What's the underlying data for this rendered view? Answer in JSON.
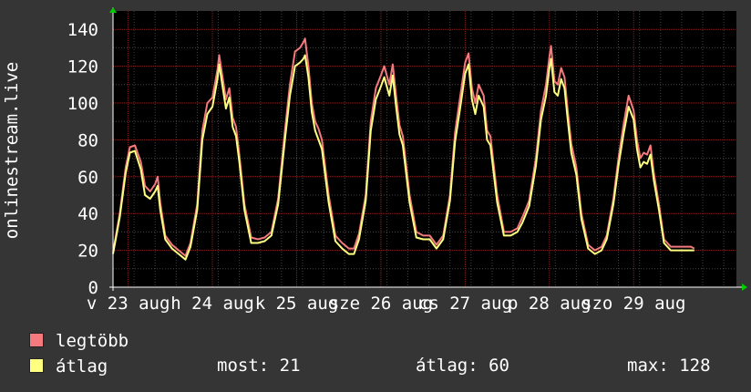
{
  "chart_data": {
    "type": "line",
    "ylabel": "onlinestream.live",
    "ylim": [
      0,
      150
    ],
    "yticks": [
      0,
      20,
      40,
      60,
      80,
      100,
      120,
      140
    ],
    "xlim": [
      0,
      7.4
    ],
    "xtick_labels": [
      {
        "x": 0.18,
        "label": "v 23 aug"
      },
      {
        "x": 1.18,
        "label": "h 24 aug"
      },
      {
        "x": 2.18,
        "label": "k 25 aug"
      },
      {
        "x": 3.18,
        "label": "sze 26 aug"
      },
      {
        "x": 4.18,
        "label": "cs 27 aug"
      },
      {
        "x": 5.18,
        "label": "p 28 aug"
      },
      {
        "x": 6.18,
        "label": "szo 29 aug"
      }
    ],
    "grid": true,
    "series": [
      {
        "name": "legtöbb",
        "color": "#f47a7d",
        "points": [
          [
            0.0,
            19
          ],
          [
            0.08,
            40
          ],
          [
            0.15,
            65
          ],
          [
            0.2,
            76
          ],
          [
            0.26,
            77
          ],
          [
            0.33,
            68
          ],
          [
            0.38,
            55
          ],
          [
            0.44,
            52
          ],
          [
            0.5,
            56
          ],
          [
            0.53,
            60
          ],
          [
            0.56,
            46
          ],
          [
            0.62,
            28
          ],
          [
            0.7,
            23
          ],
          [
            0.78,
            20
          ],
          [
            0.86,
            17
          ],
          [
            0.92,
            24
          ],
          [
            1.0,
            45
          ],
          [
            1.06,
            85
          ],
          [
            1.12,
            100
          ],
          [
            1.18,
            103
          ],
          [
            1.24,
            118
          ],
          [
            1.26,
            126
          ],
          [
            1.3,
            114
          ],
          [
            1.34,
            102
          ],
          [
            1.38,
            108
          ],
          [
            1.42,
            92
          ],
          [
            1.46,
            87
          ],
          [
            1.5,
            72
          ],
          [
            1.56,
            45
          ],
          [
            1.64,
            27
          ],
          [
            1.72,
            26
          ],
          [
            1.8,
            27
          ],
          [
            1.88,
            30
          ],
          [
            1.96,
            48
          ],
          [
            2.04,
            85
          ],
          [
            2.1,
            110
          ],
          [
            2.16,
            128
          ],
          [
            2.22,
            130
          ],
          [
            2.26,
            133
          ],
          [
            2.28,
            135
          ],
          [
            2.32,
            120
          ],
          [
            2.36,
            100
          ],
          [
            2.4,
            90
          ],
          [
            2.44,
            86
          ],
          [
            2.48,
            80
          ],
          [
            2.56,
            50
          ],
          [
            2.64,
            28
          ],
          [
            2.72,
            24
          ],
          [
            2.8,
            21
          ],
          [
            2.86,
            21
          ],
          [
            2.92,
            29
          ],
          [
            3.0,
            50
          ],
          [
            3.06,
            90
          ],
          [
            3.12,
            108
          ],
          [
            3.18,
            115
          ],
          [
            3.22,
            120
          ],
          [
            3.28,
            110
          ],
          [
            3.32,
            121
          ],
          [
            3.36,
            104
          ],
          [
            3.4,
            88
          ],
          [
            3.44,
            82
          ],
          [
            3.52,
            50
          ],
          [
            3.6,
            30
          ],
          [
            3.68,
            28
          ],
          [
            3.76,
            28
          ],
          [
            3.84,
            23
          ],
          [
            3.92,
            28
          ],
          [
            4.0,
            50
          ],
          [
            4.06,
            84
          ],
          [
            4.12,
            103
          ],
          [
            4.18,
            122
          ],
          [
            4.22,
            127
          ],
          [
            4.26,
            108
          ],
          [
            4.3,
            100
          ],
          [
            4.34,
            110
          ],
          [
            4.4,
            104
          ],
          [
            4.44,
            85
          ],
          [
            4.48,
            82
          ],
          [
            4.56,
            50
          ],
          [
            4.64,
            30
          ],
          [
            4.72,
            30
          ],
          [
            4.8,
            32
          ],
          [
            4.86,
            38
          ],
          [
            4.94,
            47
          ],
          [
            5.02,
            70
          ],
          [
            5.08,
            96
          ],
          [
            5.14,
            110
          ],
          [
            5.18,
            125
          ],
          [
            5.2,
            131
          ],
          [
            5.24,
            112
          ],
          [
            5.28,
            110
          ],
          [
            5.32,
            119
          ],
          [
            5.36,
            114
          ],
          [
            5.4,
            95
          ],
          [
            5.44,
            78
          ],
          [
            5.5,
            65
          ],
          [
            5.56,
            40
          ],
          [
            5.64,
            23
          ],
          [
            5.72,
            20
          ],
          [
            5.8,
            22
          ],
          [
            5.86,
            28
          ],
          [
            5.94,
            48
          ],
          [
            6.0,
            70
          ],
          [
            6.06,
            88
          ],
          [
            6.12,
            104
          ],
          [
            6.18,
            96
          ],
          [
            6.22,
            80
          ],
          [
            6.26,
            70
          ],
          [
            6.3,
            73
          ],
          [
            6.34,
            72
          ],
          [
            6.38,
            77
          ],
          [
            6.42,
            62
          ],
          [
            6.48,
            45
          ],
          [
            6.54,
            26
          ],
          [
            6.62,
            22
          ],
          [
            6.7,
            22
          ],
          [
            6.78,
            22
          ],
          [
            6.86,
            22
          ],
          [
            6.9,
            21
          ]
        ]
      },
      {
        "name": "átlag",
        "color": "#ffff80",
        "points": [
          [
            0.0,
            18
          ],
          [
            0.08,
            38
          ],
          [
            0.15,
            62
          ],
          [
            0.2,
            73
          ],
          [
            0.26,
            74
          ],
          [
            0.33,
            64
          ],
          [
            0.38,
            50
          ],
          [
            0.44,
            48
          ],
          [
            0.5,
            52
          ],
          [
            0.53,
            55
          ],
          [
            0.56,
            42
          ],
          [
            0.62,
            26
          ],
          [
            0.7,
            21
          ],
          [
            0.78,
            18
          ],
          [
            0.86,
            15
          ],
          [
            0.92,
            22
          ],
          [
            1.0,
            42
          ],
          [
            1.06,
            80
          ],
          [
            1.12,
            94
          ],
          [
            1.18,
            98
          ],
          [
            1.24,
            113
          ],
          [
            1.26,
            121
          ],
          [
            1.3,
            109
          ],
          [
            1.34,
            97
          ],
          [
            1.38,
            103
          ],
          [
            1.42,
            87
          ],
          [
            1.46,
            82
          ],
          [
            1.5,
            68
          ],
          [
            1.56,
            42
          ],
          [
            1.64,
            24
          ],
          [
            1.72,
            24
          ],
          [
            1.8,
            25
          ],
          [
            1.88,
            28
          ],
          [
            1.96,
            45
          ],
          [
            2.04,
            80
          ],
          [
            2.1,
            104
          ],
          [
            2.16,
            120
          ],
          [
            2.22,
            122
          ],
          [
            2.26,
            124
          ],
          [
            2.28,
            126
          ],
          [
            2.32,
            114
          ],
          [
            2.36,
            95
          ],
          [
            2.4,
            85
          ],
          [
            2.44,
            80
          ],
          [
            2.48,
            75
          ],
          [
            2.56,
            46
          ],
          [
            2.64,
            25
          ],
          [
            2.72,
            21
          ],
          [
            2.8,
            18
          ],
          [
            2.86,
            18
          ],
          [
            2.92,
            26
          ],
          [
            3.0,
            47
          ],
          [
            3.06,
            85
          ],
          [
            3.12,
            102
          ],
          [
            3.18,
            109
          ],
          [
            3.22,
            114
          ],
          [
            3.28,
            104
          ],
          [
            3.32,
            115
          ],
          [
            3.36,
            98
          ],
          [
            3.4,
            83
          ],
          [
            3.44,
            77
          ],
          [
            3.52,
            46
          ],
          [
            3.6,
            27
          ],
          [
            3.68,
            26
          ],
          [
            3.76,
            26
          ],
          [
            3.84,
            21
          ],
          [
            3.92,
            26
          ],
          [
            4.0,
            47
          ],
          [
            4.06,
            79
          ],
          [
            4.12,
            97
          ],
          [
            4.18,
            116
          ],
          [
            4.22,
            121
          ],
          [
            4.26,
            102
          ],
          [
            4.3,
            94
          ],
          [
            4.34,
            104
          ],
          [
            4.4,
            98
          ],
          [
            4.44,
            80
          ],
          [
            4.48,
            77
          ],
          [
            4.56,
            46
          ],
          [
            4.64,
            28
          ],
          [
            4.72,
            28
          ],
          [
            4.8,
            30
          ],
          [
            4.86,
            35
          ],
          [
            4.94,
            44
          ],
          [
            5.02,
            66
          ],
          [
            5.08,
            91
          ],
          [
            5.14,
            104
          ],
          [
            5.18,
            119
          ],
          [
            5.2,
            124
          ],
          [
            5.24,
            106
          ],
          [
            5.28,
            104
          ],
          [
            5.32,
            113
          ],
          [
            5.36,
            108
          ],
          [
            5.4,
            90
          ],
          [
            5.44,
            73
          ],
          [
            5.5,
            61
          ],
          [
            5.56,
            37
          ],
          [
            5.64,
            21
          ],
          [
            5.72,
            18
          ],
          [
            5.8,
            20
          ],
          [
            5.86,
            26
          ],
          [
            5.94,
            45
          ],
          [
            6.0,
            66
          ],
          [
            6.06,
            83
          ],
          [
            6.12,
            98
          ],
          [
            6.18,
            91
          ],
          [
            6.22,
            75
          ],
          [
            6.26,
            65
          ],
          [
            6.3,
            68
          ],
          [
            6.34,
            67
          ],
          [
            6.38,
            72
          ],
          [
            6.42,
            58
          ],
          [
            6.48,
            42
          ],
          [
            6.54,
            24
          ],
          [
            6.62,
            20
          ],
          [
            6.7,
            20
          ],
          [
            6.78,
            20
          ],
          [
            6.86,
            20
          ],
          [
            6.9,
            20
          ]
        ]
      }
    ]
  },
  "legend": {
    "items": [
      {
        "label": "legtöbb",
        "color": "#f47a7d"
      },
      {
        "label": "átlag",
        "color": "#ffff80"
      }
    ]
  },
  "stats": {
    "most": "most: 21",
    "atlag": "átlag: 60",
    "max": "max: 128"
  }
}
